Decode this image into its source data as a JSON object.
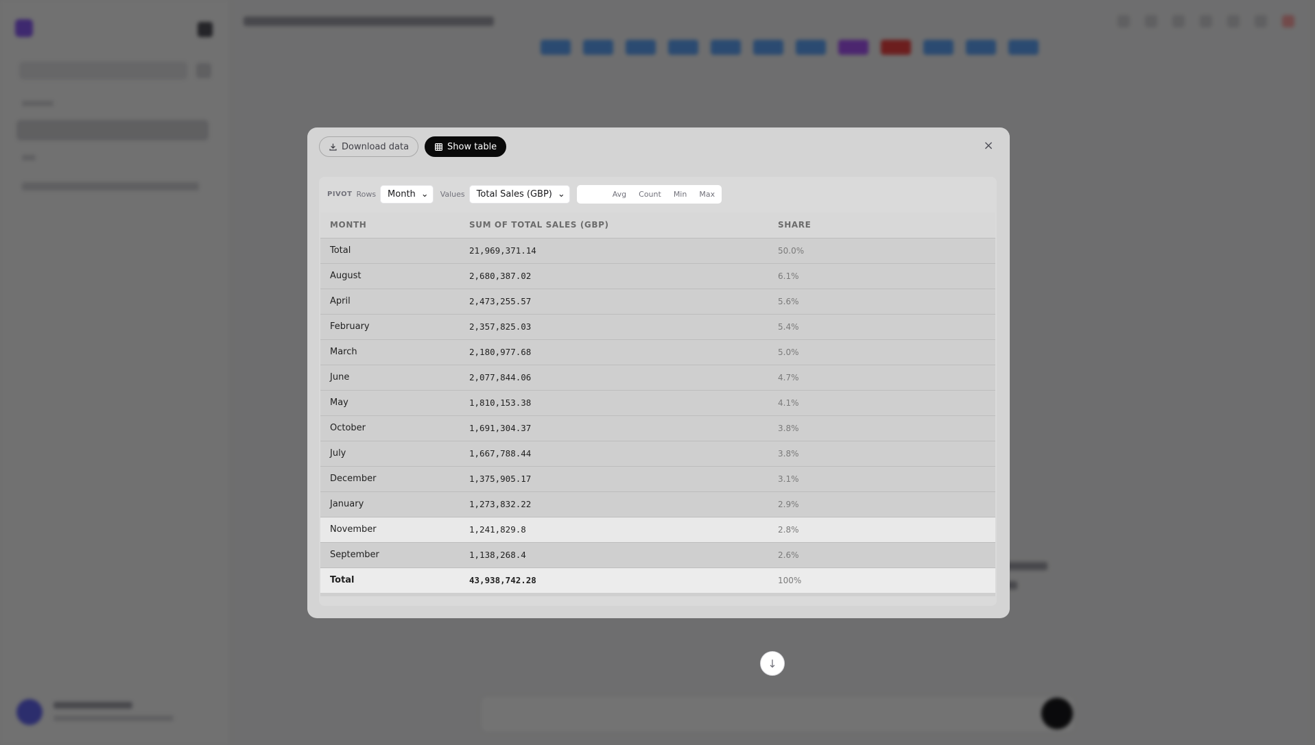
{
  "toolbar": {
    "download_label": "Download data",
    "show_table_label": "Show table"
  },
  "pivot": {
    "tag": "PIVOT",
    "rows_label": "Rows",
    "rows_value": "Month",
    "values_label": "Values",
    "values_value": "Total Sales (GBP)",
    "aggregations": [
      "Avg",
      "Count",
      "Min",
      "Max"
    ]
  },
  "table": {
    "headers": [
      "MONTH",
      "SUM OF TOTAL SALES (GBP)",
      "SHARE"
    ],
    "rows": [
      {
        "month": "Total",
        "sum": "21,969,371.14",
        "share": "50.0%"
      },
      {
        "month": "August",
        "sum": "2,680,387.02",
        "share": "6.1%"
      },
      {
        "month": "April",
        "sum": "2,473,255.57",
        "share": "5.6%"
      },
      {
        "month": "February",
        "sum": "2,357,825.03",
        "share": "5.4%"
      },
      {
        "month": "March",
        "sum": "2,180,977.68",
        "share": "5.0%"
      },
      {
        "month": "June",
        "sum": "2,077,844.06",
        "share": "4.7%"
      },
      {
        "month": "May",
        "sum": "1,810,153.38",
        "share": "4.1%"
      },
      {
        "month": "October",
        "sum": "1,691,304.37",
        "share": "3.8%"
      },
      {
        "month": "July",
        "sum": "1,667,788.44",
        "share": "3.8%"
      },
      {
        "month": "December",
        "sum": "1,375,905.17",
        "share": "3.1%"
      },
      {
        "month": "January",
        "sum": "1,273,832.22",
        "share": "2.9%"
      },
      {
        "month": "November",
        "sum": "1,241,829.8",
        "share": "2.8%"
      },
      {
        "month": "September",
        "sum": "1,138,268.4",
        "share": "2.6%"
      }
    ],
    "total": {
      "month": "Total",
      "sum": "43,938,742.28",
      "share": "100%"
    }
  },
  "icons": {
    "download": "download-icon",
    "table": "table-icon",
    "close": "close-icon",
    "scroll_down": "arrow-down-icon"
  }
}
